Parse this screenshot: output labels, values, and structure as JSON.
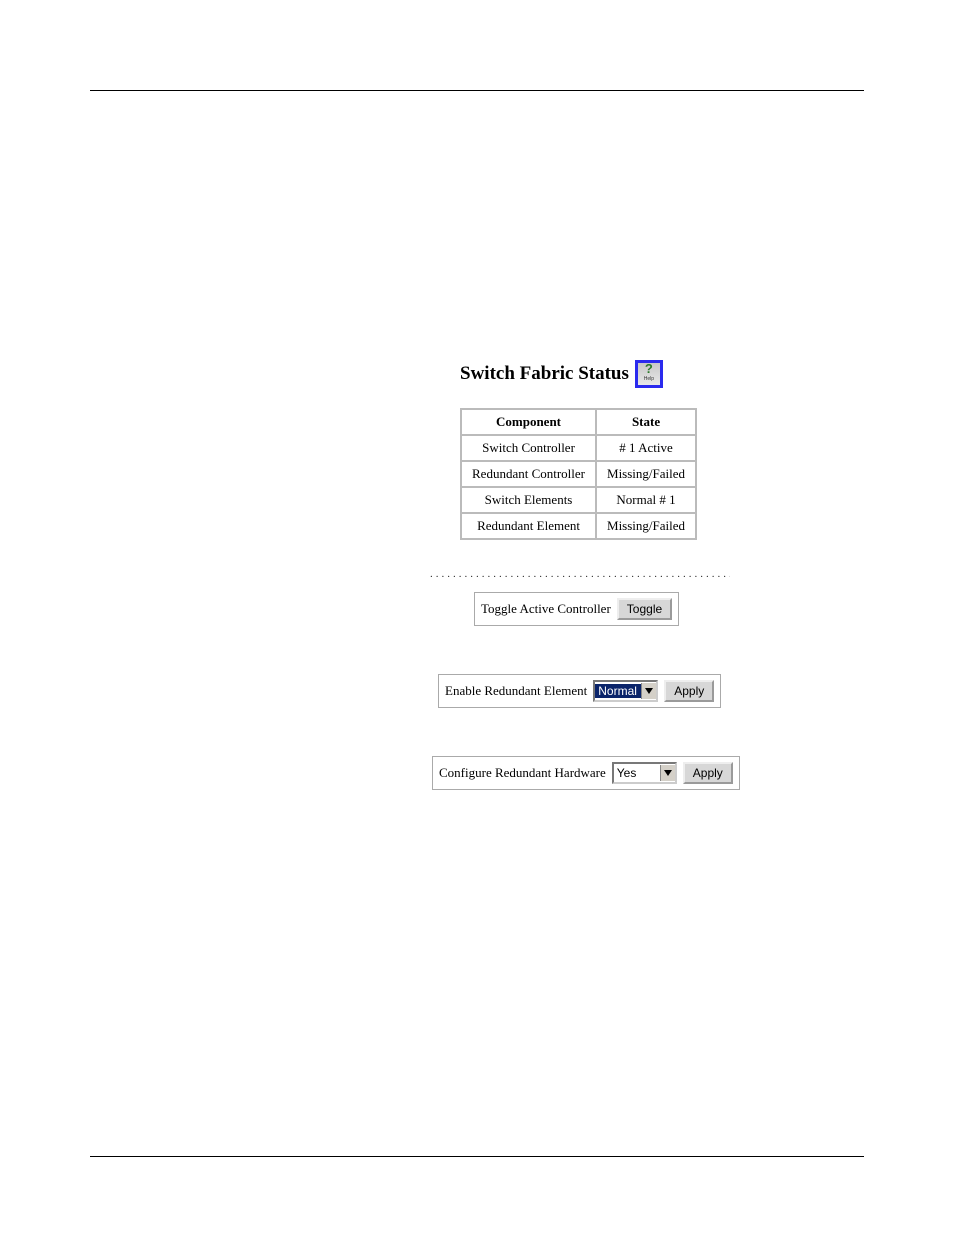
{
  "header": {
    "title": "Switch Fabric Status",
    "help_icon": "help-icon"
  },
  "table": {
    "headers": [
      "Component",
      "State"
    ],
    "rows": [
      {
        "component": "Switch Controller",
        "state": "# 1 Active"
      },
      {
        "component": "Redundant Controller",
        "state": "Missing/Failed"
      },
      {
        "component": "Switch Elements",
        "state": "Normal # 1"
      },
      {
        "component": "Redundant Element",
        "state": "Missing/Failed"
      }
    ]
  },
  "controls": {
    "toggle": {
      "label": "Toggle Active Controller",
      "button": "Toggle"
    },
    "enable": {
      "label": "Enable Redundant Element",
      "value": "Normal",
      "button": "Apply"
    },
    "configure": {
      "label": "Configure Redundant Hardware",
      "value": "Yes",
      "button": "Apply"
    }
  }
}
